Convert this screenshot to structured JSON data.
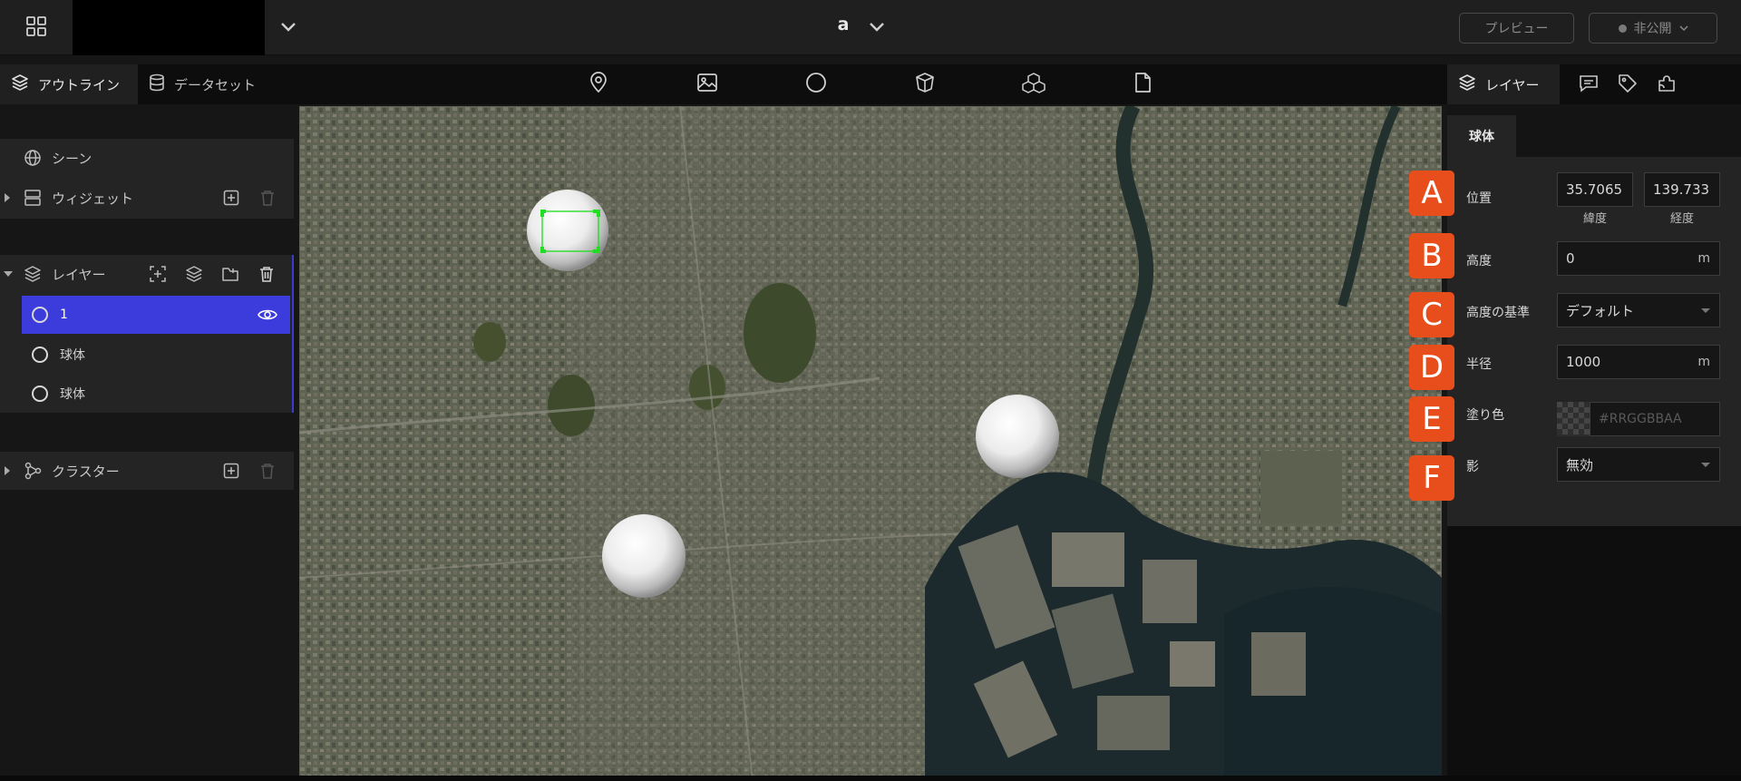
{
  "header": {
    "scene_name": "a",
    "preview_label": "プレビュー",
    "publish_label": "非公開"
  },
  "left_tabs": {
    "outline": "アウトライン",
    "dataset": "データセット"
  },
  "toolbar": {
    "tools": [
      "marker-icon",
      "image-icon",
      "sphere-icon",
      "box-icon",
      "model-icon",
      "file-icon"
    ]
  },
  "right_tabs": {
    "layer": "レイヤー"
  },
  "outline": {
    "scene": "シーン",
    "widget": "ウィジェット",
    "layer": "レイヤー",
    "layer_items": [
      {
        "label": "1",
        "selected": true
      },
      {
        "label": "球体",
        "selected": false
      },
      {
        "label": "球体",
        "selected": false
      }
    ],
    "cluster": "クラスター"
  },
  "properties": {
    "tab": "球体",
    "position_label": "位置",
    "latitude": "35.7065",
    "longitude": "139.733",
    "latitude_label": "緯度",
    "longitude_label": "経度",
    "height_label": "高度",
    "height_value": "0",
    "height_unit": "m",
    "height_ref_label": "高度の基準",
    "height_ref_value": "デフォルト",
    "radius_label": "半径",
    "radius_value": "1000",
    "radius_unit": "m",
    "fill_label": "塗り色",
    "fill_placeholder": "#RRGGBBAA",
    "shadow_label": "影",
    "shadow_value": "無効"
  },
  "badges": [
    "A",
    "B",
    "C",
    "D",
    "E",
    "F"
  ],
  "colors": {
    "accent": "#3c3cdc",
    "badge": "#e84e1b",
    "selection": "#22dd22"
  }
}
